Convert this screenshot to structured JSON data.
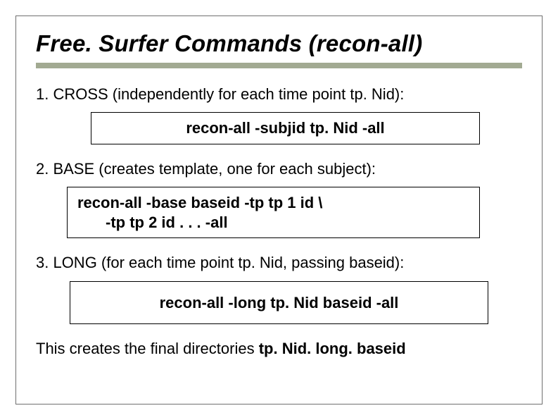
{
  "title": "Free. Surfer Commands (recon-all)",
  "steps": {
    "s1_label": "1. CROSS (independently for each time point tp. Nid):",
    "s1_cmd": "recon-all -subjid tp. Nid -all",
    "s2_label": "2. BASE (creates template, one for each subject):",
    "s2_cmd_line1": "recon-all -base baseid -tp tp 1 id \\",
    "s2_cmd_line2": "-tp tp 2 id . . . -all",
    "s3_label": "3. LONG (for each time point tp. Nid, passing baseid):",
    "s3_cmd": "recon-all -long tp. Nid baseid -all"
  },
  "final_text": "This creates the final directories ",
  "final_dirs": "tp. Nid. long. baseid"
}
